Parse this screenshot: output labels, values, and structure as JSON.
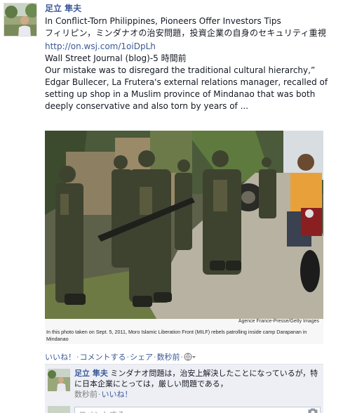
{
  "post": {
    "author": "足立 隼夫",
    "title_en": "In Conflict-Torn Philippines, Pioneers Offer Investors Tips",
    "title_jp": "フィリピン，ミンダナオの治安問題，投資企業の自身のセキュリティ重視",
    "url": "http://on.wsj.com/1oiDpLh",
    "source": "Wall Street Journal (blog)-5 時間前",
    "excerpt": "Our mistake was to disregard the traditional cultural hierarchy,” Edgar Bullecer, La Frutera's external relations manager, recalled of setting up shop in a Muslim province of Mindanao that was both deeply conservative and also torn by years of ...",
    "photo": {
      "credit": "Agence France-Presse/Getty Images",
      "caption": "In this photo taken on Sept. 5, 2011, Moro Islamic Liberation Front (MILF) rebels patrolling inside camp Darapanan in Mindanao"
    }
  },
  "actions": {
    "like": "いいね！",
    "comment": "コメントする",
    "share": "シェア",
    "time": "数秒前",
    "privacy_icon": "globe-icon"
  },
  "comment": {
    "author": "足立 隼夫",
    "text": " ミンダナオ問題は，治安上解決したことになっているが，特に日本企業にとっては，厳しい問題である，",
    "time": "数秒前",
    "like": "いいね！"
  },
  "reply": {
    "placeholder": "コメントする..."
  },
  "colors": {
    "link": "#3b5998",
    "comment_bg": "#edeff4"
  }
}
